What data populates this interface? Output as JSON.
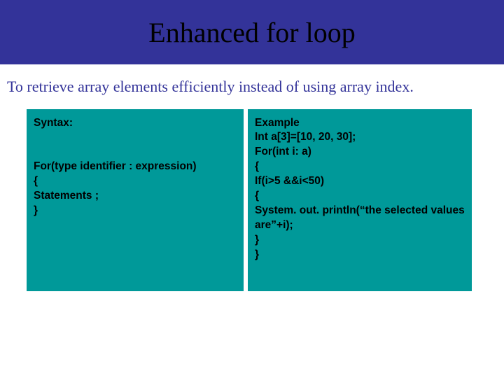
{
  "title": "Enhanced for loop",
  "intro": "To retrieve array elements efficiently instead of using array index.",
  "left": {
    "heading": "Syntax:",
    "lines": [
      "For(type identifier : expression)",
      "{",
      "Statements ;",
      "}"
    ]
  },
  "right": {
    "heading": "Example",
    "lines": [
      "Int a[3]=[10, 20, 30];",
      "For(int i: a)",
      "{",
      "If(i>5 &&i<50)",
      "{",
      "System. out. println(“the selected values are”+i);",
      "}",
      "}"
    ]
  }
}
